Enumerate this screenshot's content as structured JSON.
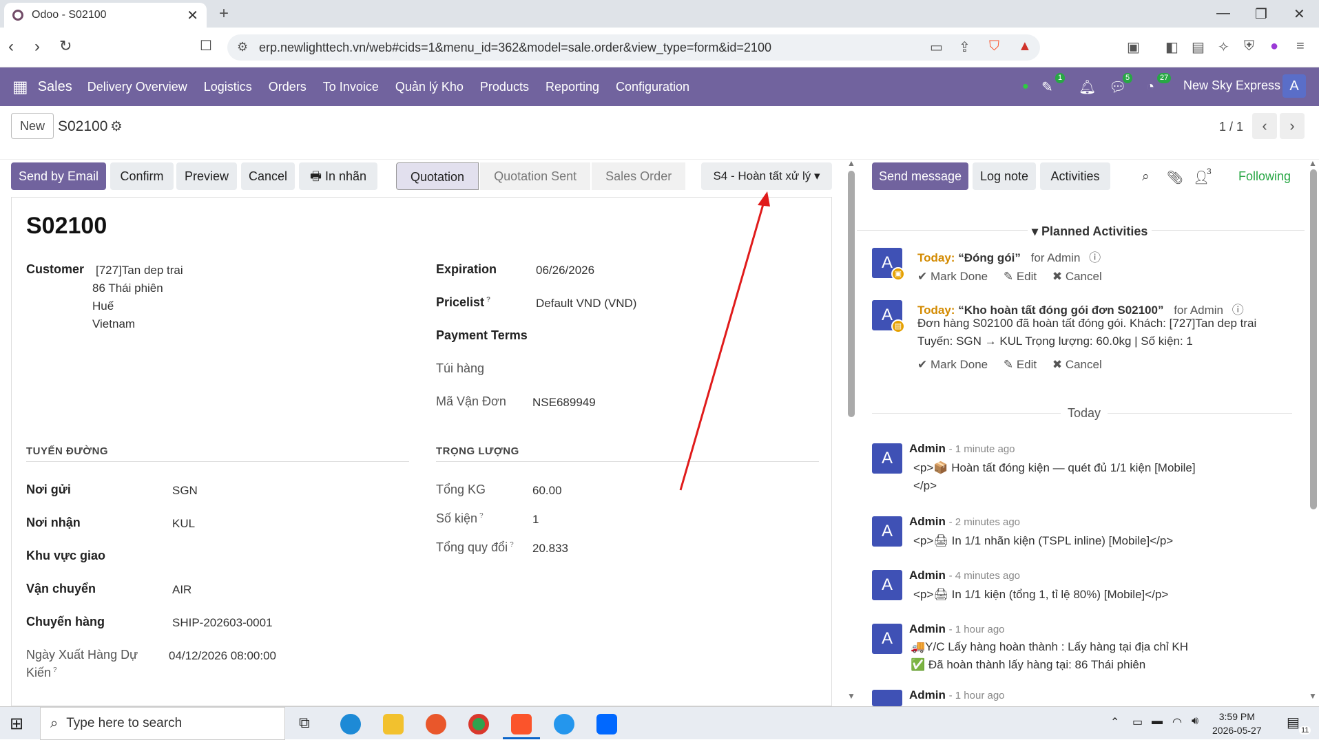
{
  "browser": {
    "tab_title": "Odoo - S02100",
    "url": "erp.newlighttech.vn/web#cids=1&menu_id=362&model=sale.order&view_type=form&id=2100"
  },
  "navbar": {
    "app_name": "Sales",
    "menu": [
      "Delivery Overview",
      "Logistics",
      "Orders",
      "To Invoice",
      "Quản lý Kho",
      "Products",
      "Reporting",
      "Configuration"
    ],
    "badges": {
      "activities": "1",
      "messages": "5",
      "clock": "27"
    },
    "company": "New Sky Express",
    "user_initial": "A"
  },
  "control": {
    "new_label": "New",
    "breadcrumb": "S02100",
    "pager": "1 / 1"
  },
  "actions": {
    "send_email": "Send by Email",
    "confirm": "Confirm",
    "preview": "Preview",
    "cancel": "Cancel",
    "print_label": "In nhãn",
    "stages": [
      "Quotation",
      "Quotation Sent",
      "Sales Order"
    ],
    "active_stage": "Quotation",
    "state_dropdown": "S4 - Hoàn tất xử lý"
  },
  "form": {
    "title": "S02100",
    "customer_label": "Customer",
    "customer_lines": [
      "[727]Tan dep trai",
      "86 Thái phiên",
      "Huế",
      "Vietnam"
    ],
    "expiration_label": "Expiration",
    "expiration": "06/26/2026",
    "pricelist_label": "Pricelist",
    "pricelist": "Default VND (VND)",
    "payment_terms_label": "Payment Terms",
    "tui_hang_label": "Túi hàng",
    "ma_van_don_label": "Mã Vận Đơn",
    "ma_van_don": "NSE689949",
    "route_section": "TUYẾN ĐƯỜNG",
    "weight_section": "TRỌNG LƯỢNG",
    "noi_gui_label": "Nơi gửi",
    "noi_gui": "SGN",
    "noi_nhan_label": "Nơi nhận",
    "noi_nhan": "KUL",
    "khu_vuc_label": "Khu vực giao",
    "van_chuyen_label": "Vận chuyển",
    "van_chuyen": "AIR",
    "chuyen_hang_label": "Chuyến hàng",
    "chuyen_hang": "SHIP-202603-0001",
    "ngay_xuat_label_1": "Ngày Xuất Hàng Dự",
    "ngay_xuat_label_2": "Kiến",
    "ngay_xuat": "04/12/2026 08:00:00",
    "tong_kg_label": "Tổng KG",
    "tong_kg": "60.00",
    "so_kien_label": "Số kiện",
    "so_kien": "1",
    "tong_quy_doi_label": "Tổng quy đổi",
    "tong_quy_doi": "20.833"
  },
  "chatter": {
    "send_message": "Send message",
    "log_note": "Log note",
    "activities": "Activities",
    "followers_count": "3",
    "following": "Following",
    "planned_title": "Planned Activities",
    "activities_list": [
      {
        "today": "Today:",
        "title": "“Đóng gói”",
        "assignee": "for Admin",
        "note": ""
      },
      {
        "today": "Today:",
        "title": "“Kho hoàn tất đóng gói đơn S02100”",
        "assignee": "for Admin",
        "note1": "Đơn hàng S02100 đã hoàn tất đóng gói. Khách: [727]Tan dep trai",
        "note2": "Tuyến: SGN → KUL Trọng lượng: 60.0kg | Số kiện: 1"
      }
    ],
    "mark_done": "Mark Done",
    "edit": "Edit",
    "cancel": "Cancel",
    "day_separator": "Today",
    "messages": [
      {
        "author": "Admin",
        "time": "- 1 minute ago",
        "line1": "<p>📦 Hoàn tất đóng kiện — quét đủ 1/1 kiện [Mobile]",
        "line2": "</p>"
      },
      {
        "author": "Admin",
        "time": "- 2 minutes ago",
        "line1": "<p>🖨 In 1/1 nhãn kiện (TSPL inline) [Mobile]</p>"
      },
      {
        "author": "Admin",
        "time": "- 4 minutes ago",
        "line1": "<p>🖨 In 1/1 kiện (tổng 1, tỉ lệ 80%) [Mobile]</p>"
      },
      {
        "author": "Admin",
        "time": "- 1 hour ago",
        "line1": "🚚Y/C Lấy hàng hoàn thành : Lấy hàng tại địa chỉ KH",
        "line2": "✅ Đã hoàn thành lấy hàng tại: 86 Thái phiên"
      },
      {
        "author": "Admin",
        "time": "- 1 hour ago"
      }
    ]
  },
  "taskbar": {
    "search_placeholder": "Type here to search",
    "time": "3:59 PM",
    "date": "2026-05-27",
    "notif_count": "11"
  },
  "colors": {
    "odoo_purple": "#71639e",
    "annotation_arrow": "#e01b1b",
    "today_orange": "#d38a00"
  }
}
